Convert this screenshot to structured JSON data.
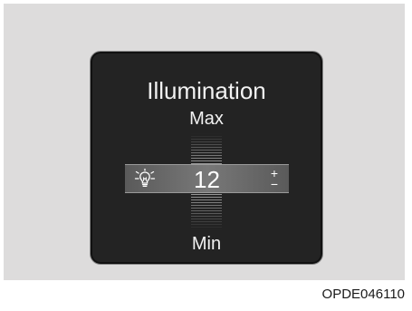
{
  "illumination": {
    "title": "Illumination",
    "max_label": "Max",
    "min_label": "Min",
    "value": "12",
    "plus_label": "+",
    "minus_label": "−",
    "icon": "bulb-icon"
  },
  "figure_code": "OPDE046110",
  "colors": {
    "screen_bg": "#232323",
    "bar_bg": "#6e6e6e",
    "text": "#f2f2f2",
    "page_bg": "#dddcdc"
  }
}
